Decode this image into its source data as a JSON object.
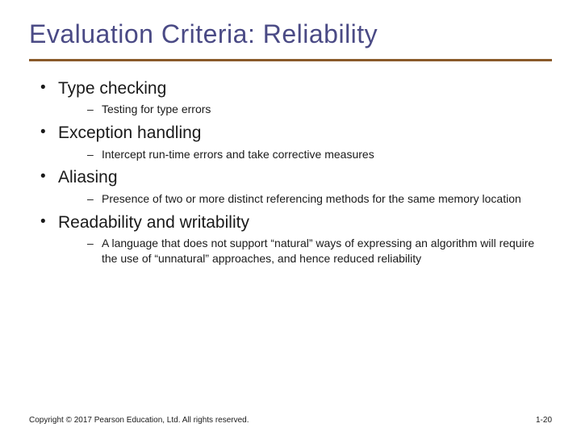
{
  "title": "Evaluation Criteria: Reliability",
  "bullets": [
    {
      "topic": "Type checking",
      "sub": [
        "Testing for type errors"
      ]
    },
    {
      "topic": "Exception handling",
      "sub": [
        "Intercept run-time errors and take corrective measures"
      ]
    },
    {
      "topic": "Aliasing",
      "sub": [
        "Presence of two or more distinct referencing methods for the same memory location"
      ]
    },
    {
      "topic": "Readability and writability",
      "sub": [
        "A language that does not support “natural” ways of expressing an algorithm will require the use  of “unnatural” approaches, and hence reduced reliability"
      ]
    }
  ],
  "footer": {
    "copyright": "Copyright © 2017 Pearson Education, Ltd. All rights reserved.",
    "page": "1-20"
  }
}
